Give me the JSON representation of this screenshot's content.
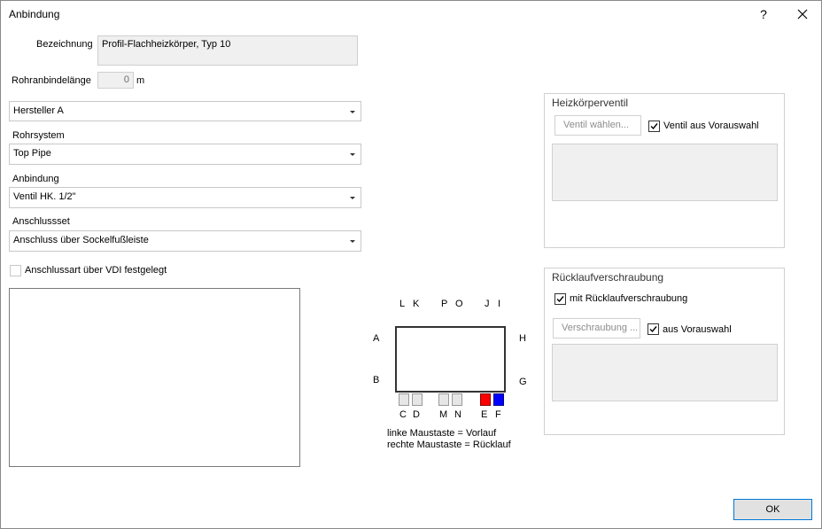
{
  "window": {
    "title": "Anbindung",
    "help": "?"
  },
  "form": {
    "bezeichnung_label": "Bezeichnung",
    "bezeichnung_value": "Profil-Flachheizkörper, Typ 10",
    "rohranbindelaenge_label": "Rohranbindelänge",
    "rohranbindelaenge_value": "0",
    "rohranbindelaenge_unit": "m",
    "hersteller_value": "Hersteller A",
    "rohrsystem_label": "Rohrsystem",
    "rohrsystem_value": "Top Pipe",
    "anbindung_label": "Anbindung",
    "anbindung_value": "Ventil HK. 1/2\"",
    "anschlussset_label": "Anschlussset",
    "anschlussset_value": "Anschluss über Sockelfußleiste",
    "vdi_label": "Anschlussart über VDI festgelegt",
    "vdi_checked": false
  },
  "diagram": {
    "top_labels": [
      "L",
      "K",
      "P",
      "O",
      "J",
      "I"
    ],
    "left_labels": [
      "A",
      "B"
    ],
    "right_labels": [
      "H",
      "G"
    ],
    "bottom_labels": [
      "C",
      "D",
      "M",
      "N",
      "E",
      "F"
    ],
    "supply_color": "#ff0000",
    "return_color": "#0000ff",
    "hint_left": "linke Maustaste = Vorlauf",
    "hint_right": "rechte Maustaste = Rücklauf"
  },
  "heizkoerperventil": {
    "title": "Heizkörperventil",
    "select_button": "Ventil wählen...",
    "checkbox_label": "Ventil aus Vorauswahl",
    "checked": true
  },
  "ruecklauf": {
    "title": "Rücklaufverschraubung",
    "checkbox_label": "mit Rücklaufverschraubung",
    "checked": true,
    "select_button": "Verschraubung ...",
    "vorauswahl_label": "aus Vorauswahl",
    "vorauswahl_checked": true
  },
  "footer": {
    "ok_label": "OK"
  }
}
